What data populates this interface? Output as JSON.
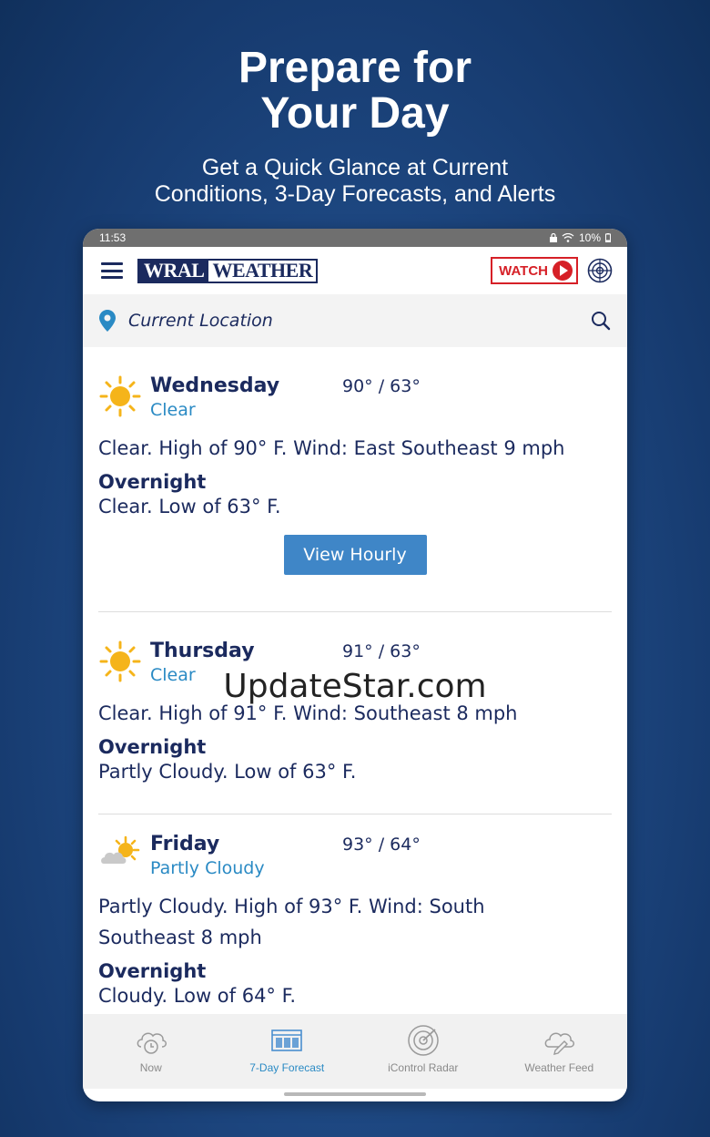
{
  "promo": {
    "title_line1": "Prepare for",
    "title_line2": "Your Day",
    "subtitle_line1": "Get a Quick Glance at Current",
    "subtitle_line2": "Conditions, 3-Day Forecasts, and Alerts"
  },
  "status_bar": {
    "time": "11:53",
    "battery": "10%"
  },
  "app_bar": {
    "logo_wral": "WRAL",
    "logo_weather": "WEATHER",
    "watch_label": "WATCH"
  },
  "location": {
    "label": "Current Location"
  },
  "days": [
    {
      "name": "Wednesday",
      "condition": "Clear",
      "temps": "90° / 63°",
      "description": "Clear. High of 90° F. Wind: East Southeast 9 mph",
      "overnight_label": "Overnight",
      "overnight_text": "Clear. Low of 63° F.",
      "icon": "sun-icon"
    },
    {
      "name": "Thursday",
      "condition": "Clear",
      "temps": "91° / 63°",
      "description": "Clear. High of 91° F. Wind: Southeast 8 mph",
      "overnight_label": "Overnight",
      "overnight_text": "Partly Cloudy. Low of 63° F.",
      "icon": "sun-icon"
    },
    {
      "name": "Friday",
      "condition": "Partly Cloudy",
      "temps": "93° / 64°",
      "description": "Partly Cloudy. High of 93° F. Wind: South Southeast 8 mph",
      "overnight_label": "Overnight",
      "overnight_text": "Cloudy. Low of 64° F.",
      "icon": "partly-cloudy-icon"
    }
  ],
  "view_hourly_label": "View Hourly",
  "watermark": "UpdateStar.com",
  "bottom_nav": [
    {
      "label": "Now",
      "icon": "cloud-clock-icon",
      "active": false
    },
    {
      "label": "7-Day Forecast",
      "icon": "calendar-icon",
      "active": true
    },
    {
      "label": "iControl Radar",
      "icon": "radar-icon",
      "active": false
    },
    {
      "label": "Weather Feed",
      "icon": "cloud-pencil-icon",
      "active": false
    }
  ],
  "colors": {
    "navy": "#1b2a5e",
    "accent_blue": "#2a8ac4",
    "button_blue": "#3f86c7",
    "watch_red": "#d62027",
    "sun_yellow": "#f5b41a"
  }
}
